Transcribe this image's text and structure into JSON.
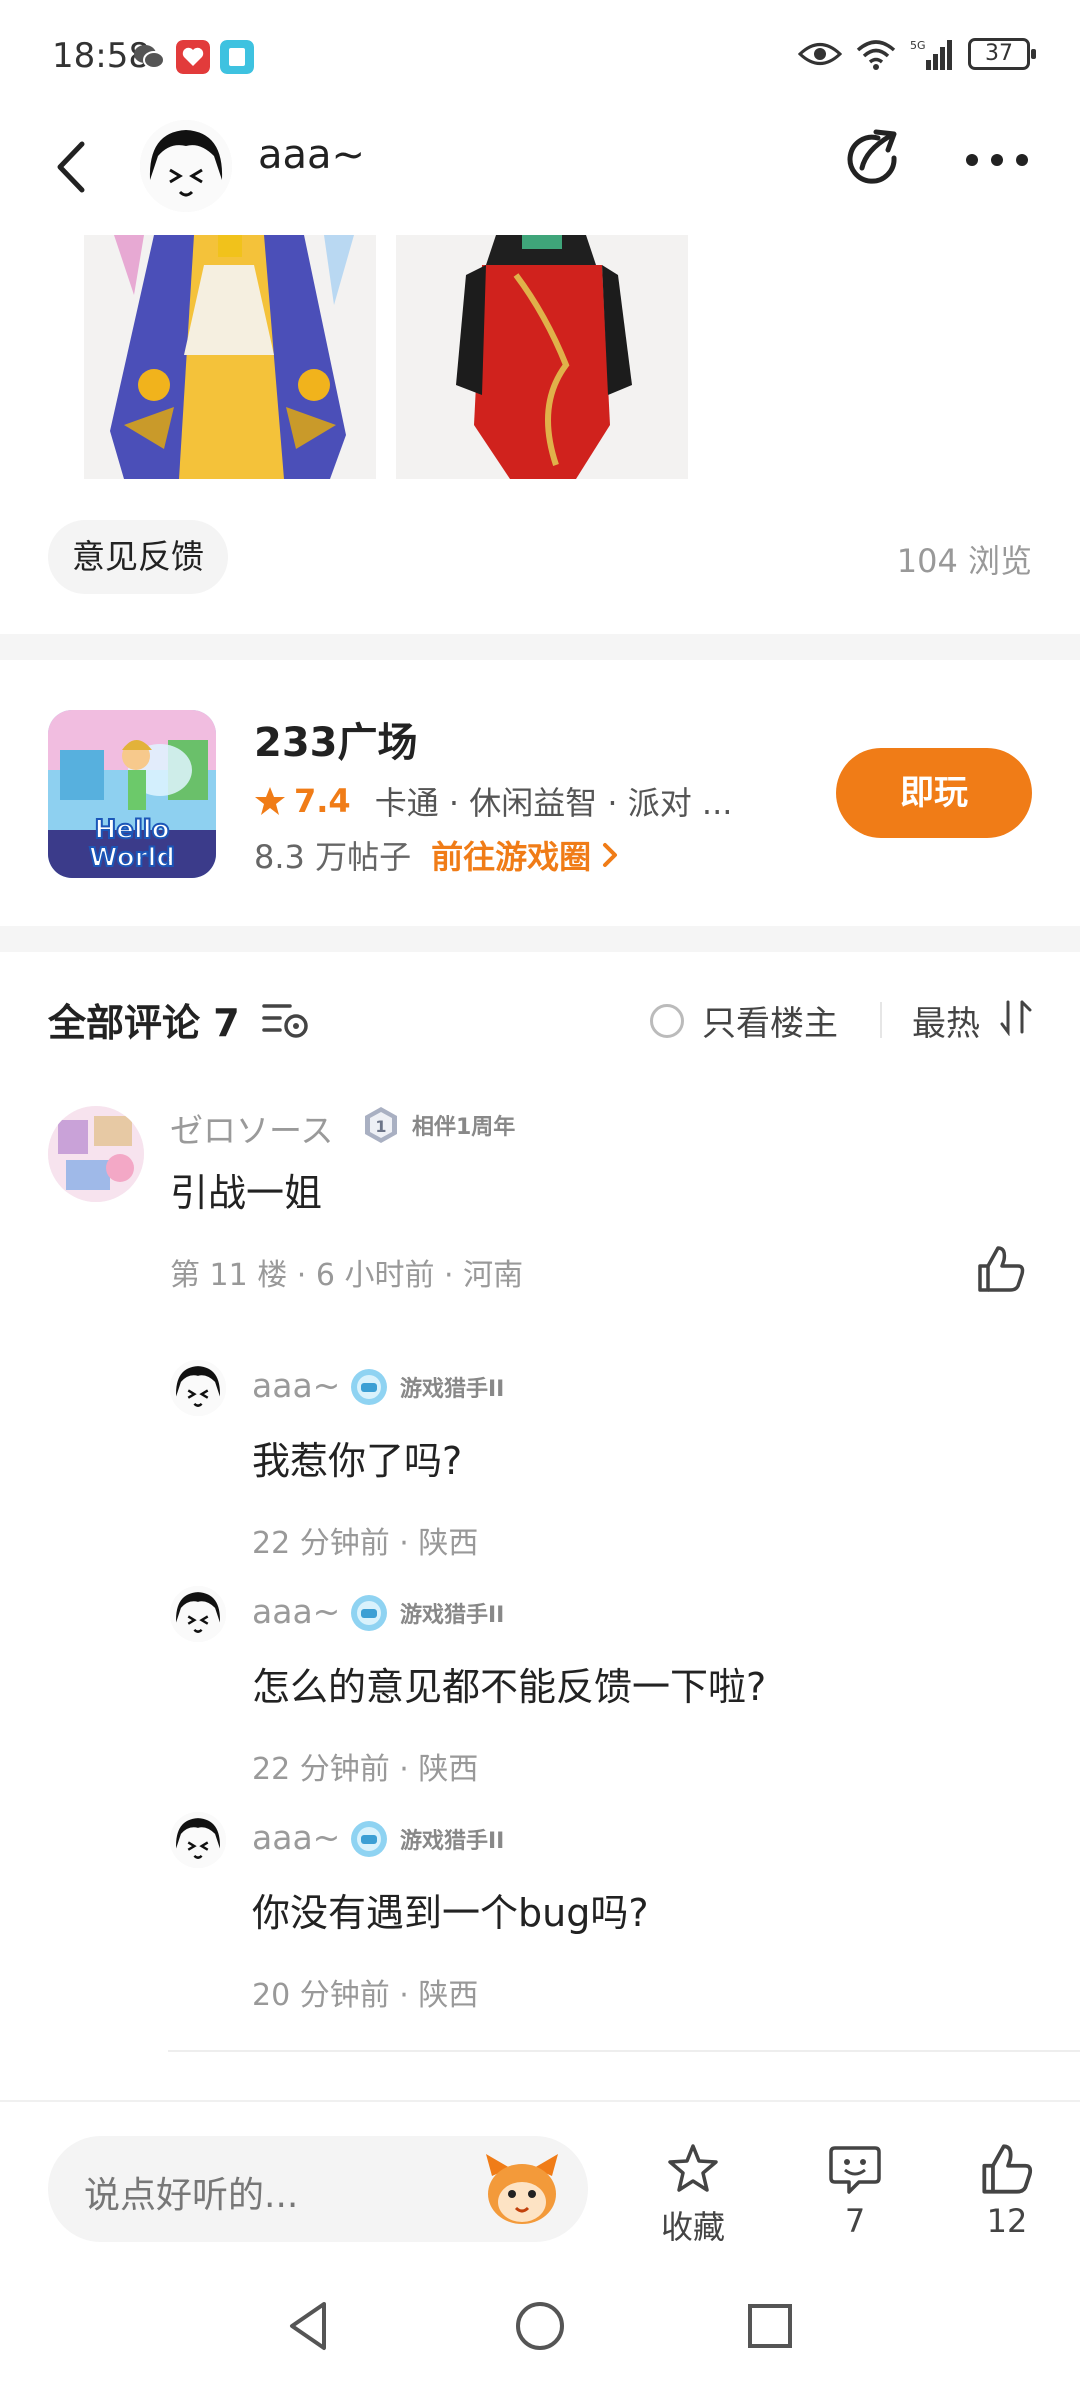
{
  "status_bar": {
    "time": "18:58",
    "battery": "37",
    "network": "5G"
  },
  "header": {
    "username": "aaa~"
  },
  "post": {
    "feedback_chip": "意见反馈",
    "views": "104 浏览"
  },
  "game_card": {
    "title": "233广场",
    "rating": "7.4",
    "tags": "卡通 · 休闲益智 · 派对 ...",
    "posts_count": "8.3 万帖子",
    "circle_link": "前往游戏圈",
    "play_label": "即玩",
    "icon_text": "Hello World"
  },
  "comments": {
    "title": "全部评论 7",
    "op_only": "只看楼主",
    "sort_label": "最热",
    "items": [
      {
        "user": "ゼロソース",
        "badge": "相伴1周年",
        "text": "引战一姐",
        "meta": "第 11 楼 · 6 小时前 · 河南"
      }
    ],
    "replies": [
      {
        "user": "aaa~",
        "badge": "游戏猎手II",
        "text": "我惹你了吗?",
        "meta": "22 分钟前 · 陕西"
      },
      {
        "user": "aaa~",
        "badge": "游戏猎手II",
        "text": "怎么的意见都不能反馈一下啦?",
        "meta": "22 分钟前 · 陕西"
      },
      {
        "user": "aaa~",
        "badge": "游戏猎手II",
        "text": "你没有遇到一个bug吗?",
        "meta": "20 分钟前 · 陕西"
      }
    ]
  },
  "bottom_bar": {
    "placeholder": "说点好听的...",
    "favorite_label": "收藏",
    "comment_count": "7",
    "like_count": "12"
  },
  "colors": {
    "accent": "#f07c17",
    "muted": "#999999",
    "band": "#f5f5f5"
  }
}
